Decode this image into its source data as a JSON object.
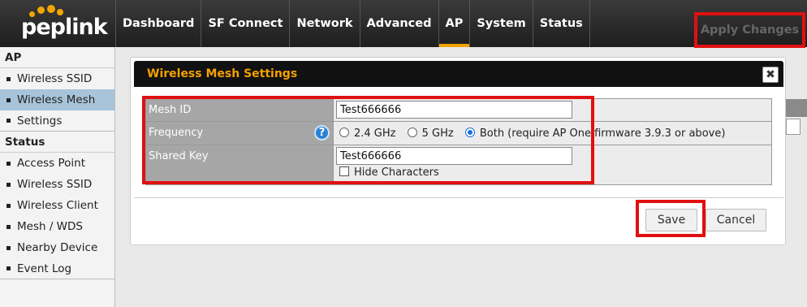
{
  "brand": {
    "logo_text": "peplink",
    "accent": "#f0a000"
  },
  "nav": {
    "items": [
      "Dashboard",
      "SF Connect",
      "Network",
      "Advanced",
      "AP",
      "System",
      "Status"
    ],
    "active": "AP",
    "apply_label": "Apply Changes"
  },
  "sidebar": {
    "section_ap": "AP",
    "ap_items": [
      "Wireless SSID",
      "Wireless Mesh",
      "Settings"
    ],
    "active_item": "Wireless Mesh",
    "section_status": "Status",
    "status_items": [
      "Access Point",
      "Wireless SSID",
      "Wireless Client",
      "Mesh / WDS",
      "Nearby Device",
      "Event Log"
    ]
  },
  "dialog": {
    "title": "Wireless Mesh Settings",
    "close_glyph": "✖",
    "mesh_id": {
      "label": "Mesh ID",
      "value": "Test666666"
    },
    "frequency": {
      "label": "Frequency",
      "help_glyph": "?",
      "options": [
        "2.4 GHz",
        "5 GHz",
        "Both (require AP One firmware 3.9.3 or above)"
      ],
      "selected": "Both (require AP One firmware 3.9.3 or above)"
    },
    "shared_key": {
      "label": "Shared Key",
      "value": "Test666666",
      "hide_label": "Hide Characters",
      "hide_checked": false
    },
    "save_label": "Save",
    "cancel_label": "Cancel"
  },
  "colors": {
    "highlight": "#e01010",
    "active_sidebar": "#a7c4da",
    "title_text": "#f3a000"
  }
}
